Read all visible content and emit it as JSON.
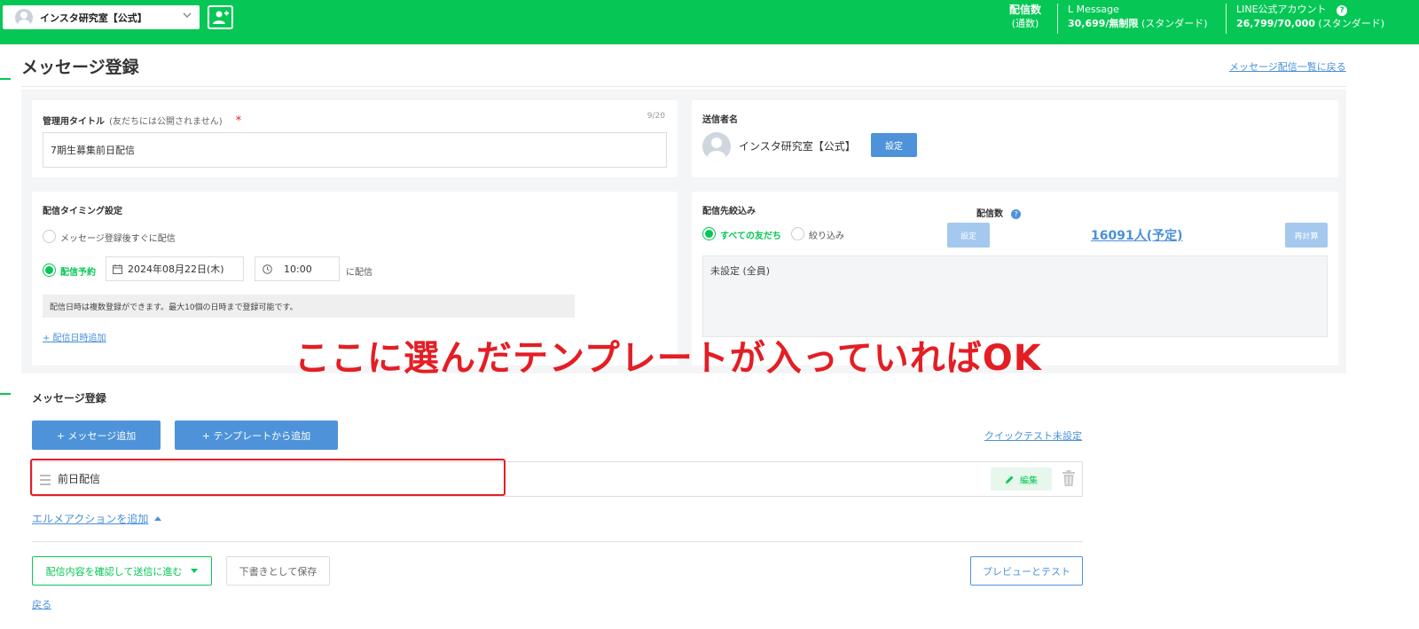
{
  "topbar": {
    "account_name": "インスタ研究室【公式】",
    "delivery_count_label": "配信数",
    "delivery_count_sub": "(通数)",
    "lmessage_label": "L Message",
    "lmessage_value": "30,699/無制限",
    "lmessage_plan": "(スタンダード)",
    "line_label": "LINE公式アカウント",
    "line_value": "26,799/70,000",
    "line_plan": "(スタンダード)",
    "help": "?"
  },
  "header": {
    "title": "メッセージ登録",
    "back_link": "メッセージ配信一覧に戻る"
  },
  "admin_title": {
    "label": "管理用タイトル",
    "note": "(友だちには公開されません)",
    "required": "*",
    "counter": "9/20",
    "value": "7期生募集前日配信"
  },
  "sender": {
    "label": "送信者名",
    "name": "インスタ研究室【公式】",
    "set_button": "設定"
  },
  "timing": {
    "label": "配信タイミング設定",
    "option_immediate": "メッセージ登録後すぐに配信",
    "option_reserved": "配信予約",
    "date": "2024年08月22日(木)",
    "time": "10:00",
    "suffix": "に配信",
    "hint": "配信日時は複数登録ができます。最大10個の日時まで登録可能です。",
    "add_link": "+ 配信日時追加"
  },
  "target": {
    "label": "配信先絞込み",
    "option_all": "すべての友だち",
    "option_filter": "絞り込み",
    "set_button": "設定",
    "count_label": "配信数",
    "count_value": "16091人(予定)",
    "recalc_button": "再計算",
    "filter_summary": "未設定 (全員)"
  },
  "annotation": "ここに選んだテンプレートが入っていればOK",
  "messages": {
    "title": "メッセージ登録",
    "add_message": "+ メッセージ追加",
    "add_template": "+ テンプレートから追加",
    "quick_test": "クイックテスト未設定",
    "item_name": "前日配信",
    "edit_button": "編集",
    "action_link": "エルメアクションを追加"
  },
  "footer": {
    "confirm_button": "配信内容を確認して送信に進む",
    "draft_button": "下書きとして保存",
    "preview_button": "プレビューとテスト",
    "back_link": "戻る"
  },
  "colors": {
    "brand_green": "#06c755",
    "link_blue": "#4a90d9",
    "annotation_red": "#e31e24"
  }
}
